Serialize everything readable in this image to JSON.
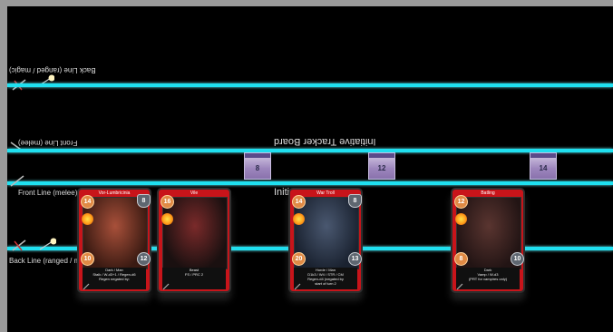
{
  "lanes": {
    "back_line_flipped": "Back Line (ranged / magic)",
    "front_line_flipped": "Front Line (melee)",
    "front_line": "Front Line (melee)",
    "back_line": "Back Line (ranged / magi"
  },
  "tracker": {
    "title_flipped": "Initiative Tracker Board",
    "title_partial": "Initi",
    "slots": [
      {
        "value": "8"
      },
      {
        "value": "12"
      },
      {
        "value": "14"
      }
    ]
  },
  "cards": [
    {
      "name": "Vor-Lumbricinia",
      "speed": "14",
      "shield": "8",
      "hp": "10",
      "armor": "12",
      "lines": [
        "Dark / Man",
        "Stalk / W-d3+1 / Regen-d6",
        "Regen negated by:"
      ],
      "art_colors": [
        "#3a1a12",
        "#a8503a"
      ]
    },
    {
      "name": "Vile",
      "speed": "16",
      "shield": "",
      "hp": "",
      "armor": "",
      "lines": [
        "Beast",
        "FS / PRC 2"
      ],
      "art_colors": [
        "#1a1010",
        "#7a2a2a"
      ]
    },
    {
      "name": "War Troll",
      "speed": "14",
      "shield": "8",
      "hp": "20",
      "armor": "13",
      "lines": [
        "Horde / Man",
        "D1k3 / W4 / STR / CM",
        "Regen-d4 (negated by",
        "start of turn 2"
      ],
      "art_colors": [
        "#1a2230",
        "#4a5870"
      ]
    },
    {
      "name": "Batling",
      "speed": "12",
      "shield": "",
      "hp": "8",
      "armor": "10",
      "lines": [
        "Dark",
        "Vamp / W-d3",
        "(PRT for vampires only)"
      ],
      "art_colors": [
        "#221414",
        "#5a3530"
      ]
    }
  ]
}
